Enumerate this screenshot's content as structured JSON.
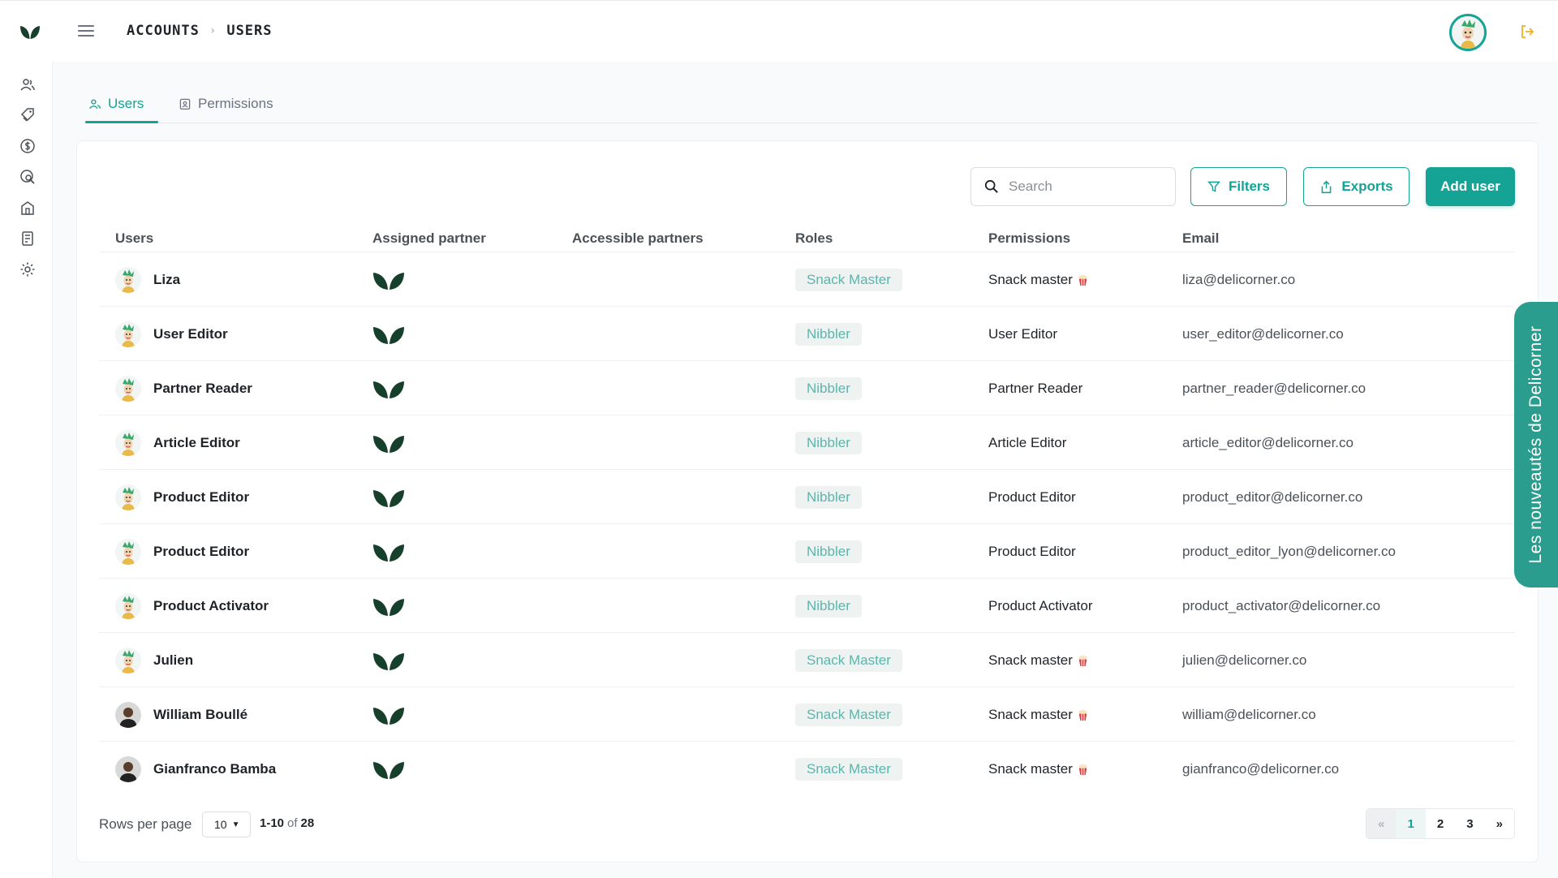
{
  "breadcrumb": {
    "parent": "ACCOUNTS",
    "current": "USERS"
  },
  "tabs": {
    "users": "Users",
    "permissions": "Permissions"
  },
  "toolbar": {
    "search_placeholder": "Search",
    "filters_label": "Filters",
    "exports_label": "Exports",
    "add_user_label": "Add user"
  },
  "table": {
    "headers": [
      "Users",
      "Assigned partner",
      "Accessible partners",
      "Roles",
      "Permissions",
      "Email"
    ],
    "rows": [
      {
        "name": "Liza",
        "role": "Snack Master",
        "permission": "Snack master",
        "email": "liza@delicorner.co",
        "avatar": "cartoon",
        "permission_icon": "popcorn-icon"
      },
      {
        "name": "User Editor",
        "role": "Nibbler",
        "permission": "User Editor",
        "email": "user_editor@delicorner.co",
        "avatar": "cartoon"
      },
      {
        "name": "Partner Reader",
        "role": "Nibbler",
        "permission": "Partner Reader",
        "email": "partner_reader@delicorner.co",
        "avatar": "cartoon"
      },
      {
        "name": "Article Editor",
        "role": "Nibbler",
        "permission": "Article Editor",
        "email": "article_editor@delicorner.co",
        "avatar": "cartoon"
      },
      {
        "name": "Product Editor",
        "role": "Nibbler",
        "permission": "Product Editor",
        "email": "product_editor@delicorner.co",
        "avatar": "cartoon"
      },
      {
        "name": "Product Editor",
        "role": "Nibbler",
        "permission": "Product Editor",
        "email": "product_editor_lyon@delicorner.co",
        "avatar": "cartoon"
      },
      {
        "name": "Product Activator",
        "role": "Nibbler",
        "permission": "Product Activator",
        "email": "product_activator@delicorner.co",
        "avatar": "cartoon"
      },
      {
        "name": "Julien",
        "role": "Snack Master",
        "permission": "Snack master",
        "email": "julien@delicorner.co",
        "avatar": "cartoon",
        "permission_icon": "popcorn-icon"
      },
      {
        "name": "William Boullé",
        "role": "Snack Master",
        "permission": "Snack master",
        "email": "william@delicorner.co",
        "avatar": "photo",
        "permission_icon": "popcorn-icon"
      },
      {
        "name": "Gianfranco Bamba",
        "role": "Snack Master",
        "permission": "Snack master",
        "email": "gianfranco@delicorner.co",
        "avatar": "photo",
        "permission_icon": "popcorn-icon"
      }
    ]
  },
  "pagination": {
    "rows_per_page_label": "Rows per page",
    "rows_per_page": "10",
    "range": "1-10",
    "of_label": "of",
    "total": "28",
    "prev": "«",
    "pages": [
      "1",
      "2",
      "3"
    ],
    "next": "»",
    "current_page": "1"
  },
  "side_panel": {
    "label": "Les nouveautés de Delicorner"
  },
  "colors": {
    "accent": "#14a394",
    "role_badge_bg": "#eef3f2",
    "role_badge_text": "#5bb5ad",
    "logo": "#17402c",
    "side_panel": "#2a9d8f"
  }
}
